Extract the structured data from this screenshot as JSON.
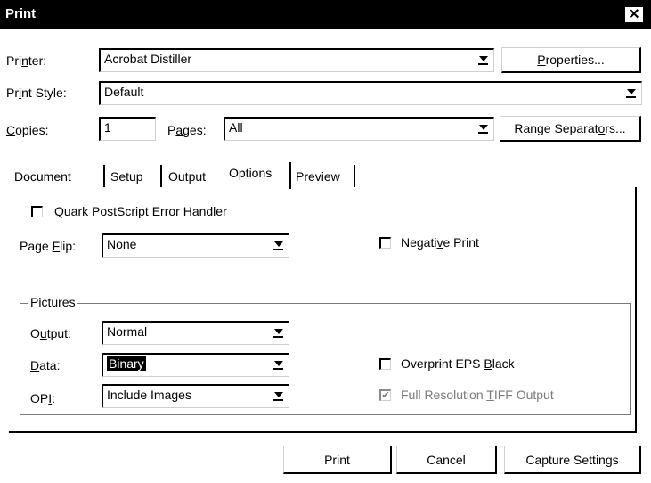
{
  "window": {
    "title": "Print"
  },
  "printer": {
    "label": "Printer:",
    "value": "Acrobat Distiller",
    "properties_button": "Properties..."
  },
  "print_style": {
    "label": "Print Style:",
    "value": "Default"
  },
  "copies": {
    "label": "Copies:",
    "value": "1"
  },
  "pages": {
    "label": "Pages:",
    "value": "All",
    "range_button": "Range Separators..."
  },
  "tabs": [
    {
      "label": "Document"
    },
    {
      "label": "Setup"
    },
    {
      "label": "Output"
    },
    {
      "label": "Options"
    },
    {
      "label": "Preview"
    }
  ],
  "active_tab": "Options",
  "options": {
    "quark_error_handler": {
      "label": "Quark PostScript Error Handler",
      "checked": false
    },
    "page_flip": {
      "label": "Page Flip:",
      "value": "None"
    },
    "negative_print": {
      "label": "Negative Print",
      "checked": false
    }
  },
  "pictures": {
    "group_label": "Pictures",
    "output": {
      "label": "Output:",
      "value": "Normal"
    },
    "data": {
      "label": "Data:",
      "value": "Binary"
    },
    "opi": {
      "label": "OPI:",
      "value": "Include Images"
    },
    "overprint_eps_black": {
      "label": "Overprint EPS Black",
      "checked": false
    },
    "full_res_tiff": {
      "label": "Full Resolution TIFF Output",
      "checked": true,
      "disabled": true
    }
  },
  "buttons": {
    "print": "Print",
    "cancel": "Cancel",
    "capture": "Capture Settings"
  }
}
